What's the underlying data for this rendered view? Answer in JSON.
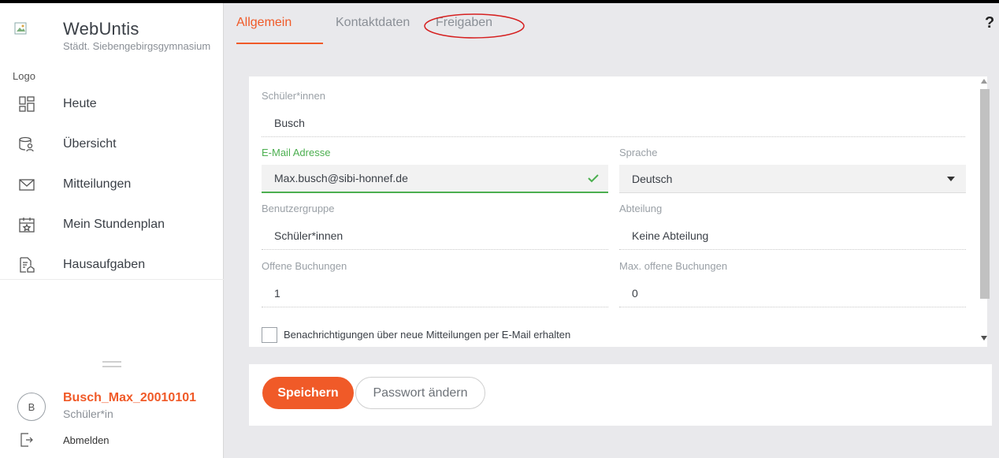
{
  "sidebar": {
    "logo_alt": "Logo",
    "brand_title": "WebUntis",
    "school_name": "Städt. Siebengebirgsgymnasium",
    "items": [
      {
        "label": "Heute",
        "icon": "dashboard-icon"
      },
      {
        "label": "Übersicht",
        "icon": "database-user-icon"
      },
      {
        "label": "Mitteilungen",
        "icon": "envelope-icon"
      },
      {
        "label": "Mein Stundenplan",
        "icon": "calendar-star-icon"
      },
      {
        "label": "Hausaufgaben",
        "icon": "document-home-icon"
      }
    ],
    "user": {
      "initial": "B",
      "name": "Busch_Max_20010101",
      "role": "Schüler*in"
    },
    "logout_label": "Abmelden"
  },
  "tabs": [
    {
      "label": "Allgemein",
      "active": true
    },
    {
      "label": "Kontaktdaten",
      "active": false
    },
    {
      "label": "Freigaben",
      "active": false
    }
  ],
  "help_label": "?",
  "form": {
    "student": {
      "label": "Schüler*innen",
      "value": "Busch"
    },
    "email": {
      "label": "E-Mail Adresse",
      "value": "Max.busch@sibi-honnef.de"
    },
    "language": {
      "label": "Sprache",
      "value": "Deutsch"
    },
    "user_group": {
      "label": "Benutzergruppe",
      "value": "Schüler*innen"
    },
    "department": {
      "label": "Abteilung",
      "value": "Keine Abteilung"
    },
    "open_bookings": {
      "label": "Offene Buchungen",
      "value": "1"
    },
    "max_open_bookings": {
      "label": "Max. offene Buchungen",
      "value": "0"
    },
    "notify_label": "Benachrichtigungen über neue Mitteilungen per E-Mail erhalten"
  },
  "buttons": {
    "save": "Speichern",
    "change_password": "Passwort ändern"
  },
  "colors": {
    "accent": "#f05a28",
    "valid": "#4caf50",
    "annotation": "#d62020"
  }
}
